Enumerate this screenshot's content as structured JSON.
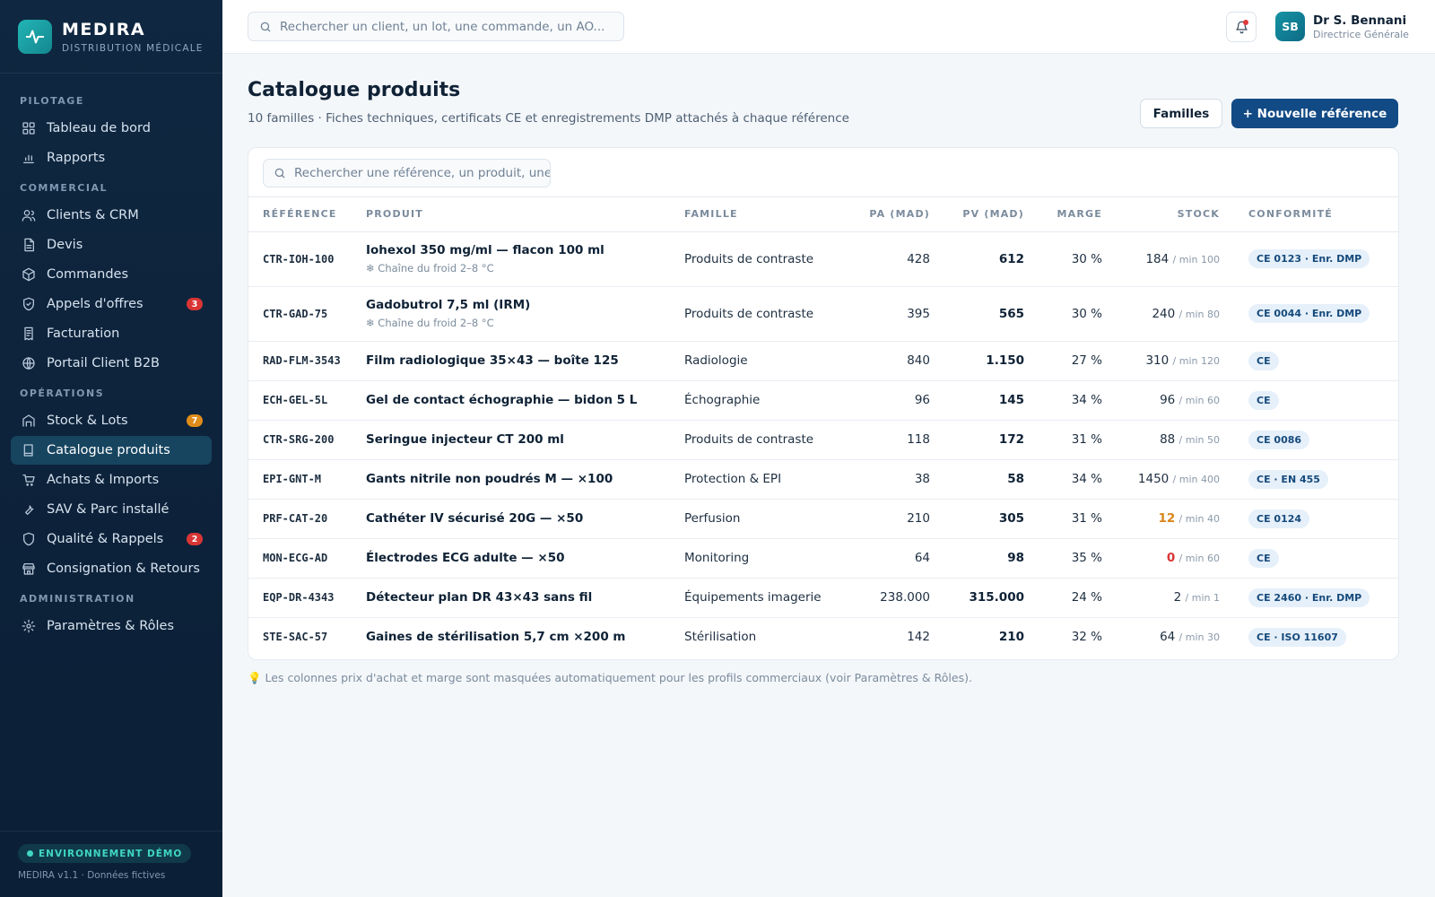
{
  "brand": {
    "name": "MEDIRA",
    "subtitle": "DISTRIBUTION MÉDICALE"
  },
  "sidebar": {
    "sections": [
      {
        "title": "PILOTAGE",
        "items": [
          {
            "label": "Tableau de bord",
            "icon": "dashboard-icon"
          },
          {
            "label": "Rapports",
            "icon": "bar-chart-icon"
          }
        ]
      },
      {
        "title": "COMMERCIAL",
        "items": [
          {
            "label": "Clients & CRM",
            "icon": "users-icon"
          },
          {
            "label": "Devis",
            "icon": "document-icon"
          },
          {
            "label": "Commandes",
            "icon": "box-icon"
          },
          {
            "label": "Appels d'offres",
            "icon": "shield-icon",
            "badge": "3",
            "badge_color": "#d93535"
          },
          {
            "label": "Facturation",
            "icon": "receipt-icon"
          },
          {
            "label": "Portail Client B2B",
            "icon": "globe-icon"
          }
        ]
      },
      {
        "title": "OPÉRATIONS",
        "items": [
          {
            "label": "Stock & Lots",
            "icon": "warehouse-icon",
            "badge": "7",
            "badge_color": "#e08c1a"
          },
          {
            "label": "Catalogue produits",
            "icon": "book-icon",
            "active": true
          },
          {
            "label": "Achats & Imports",
            "icon": "cart-icon"
          },
          {
            "label": "SAV & Parc installé",
            "icon": "wrench-icon"
          },
          {
            "label": "Qualité & Rappels",
            "icon": "shield-check-icon",
            "badge": "2",
            "badge_color": "#d93535"
          },
          {
            "label": "Consignation & Retours",
            "icon": "store-icon"
          }
        ]
      },
      {
        "title": "ADMINISTRATION",
        "items": [
          {
            "label": "Paramètres & Rôles",
            "icon": "gear-icon"
          }
        ]
      }
    ],
    "footer": {
      "env_label": "ENVIRONNEMENT DÉMO",
      "version": "MEDIRA v1.1 · Données fictives"
    }
  },
  "topbar": {
    "search_placeholder": "Rechercher un client, un lot, une commande, un AO...",
    "user": {
      "initials": "SB",
      "name": "Dr S. Bennani",
      "role": "Directrice Générale"
    }
  },
  "page": {
    "title": "Catalogue produits",
    "subtitle": "10 familles · Fiches techniques, certificats CE et enregistrements DMP attachés à chaque référence",
    "btn_families": "Familles",
    "btn_new": "+ Nouvelle référence",
    "table_search_placeholder": "Rechercher une référence, un produit, une famille",
    "footnote": "💡 Les colonnes prix d'achat et marge sont masquées automatiquement pour les profils commerciaux (voir Paramètres & Rôles)."
  },
  "table": {
    "columns": {
      "ref": "RÉFÉRENCE",
      "product": "PRODUIT",
      "family": "FAMILLE",
      "pa": "PA (MAD)",
      "pv": "PV (MAD)",
      "margin": "MARGE",
      "stock": "STOCK",
      "compliance": "CONFORMITÉ"
    },
    "rows": [
      {
        "ref": "CTR-IOH-100",
        "product": "Iohexol 350 mg/ml — flacon 100 ml",
        "note": "❄ Chaîne du froid 2–8 °C",
        "family": "Produits de contraste",
        "pa": "428",
        "pv": "612",
        "margin": "30 %",
        "stock": "184",
        "stock_min": "/ min 100",
        "stock_status": "ok",
        "compliance": "CE 0123 · Enr. DMP"
      },
      {
        "ref": "CTR-GAD-75",
        "product": "Gadobutrol 7,5 ml (IRM)",
        "note": "❄ Chaîne du froid 2–8 °C",
        "family": "Produits de contraste",
        "pa": "395",
        "pv": "565",
        "margin": "30 %",
        "stock": "240",
        "stock_min": "/ min 80",
        "stock_status": "ok",
        "compliance": "CE 0044 · Enr. DMP"
      },
      {
        "ref": "RAD-FLM-3543",
        "product": "Film radiologique 35×43 — boîte 125",
        "note": "",
        "family": "Radiologie",
        "pa": "840",
        "pv": "1.150",
        "margin": "27 %",
        "stock": "310",
        "stock_min": "/ min 120",
        "stock_status": "ok",
        "compliance": "CE"
      },
      {
        "ref": "ECH-GEL-5L",
        "product": "Gel de contact échographie — bidon 5 L",
        "note": "",
        "family": "Échographie",
        "pa": "96",
        "pv": "145",
        "margin": "34 %",
        "stock": "96",
        "stock_min": "/ min 60",
        "stock_status": "ok",
        "compliance": "CE"
      },
      {
        "ref": "CTR-SRG-200",
        "product": "Seringue injecteur CT 200 ml",
        "note": "",
        "family": "Produits de contraste",
        "pa": "118",
        "pv": "172",
        "margin": "31 %",
        "stock": "88",
        "stock_min": "/ min 50",
        "stock_status": "ok",
        "compliance": "CE 0086"
      },
      {
        "ref": "EPI-GNT-M",
        "product": "Gants nitrile non poudrés M — ×100",
        "note": "",
        "family": "Protection & EPI",
        "pa": "38",
        "pv": "58",
        "margin": "34 %",
        "stock": "1450",
        "stock_min": "/ min 400",
        "stock_status": "ok",
        "compliance": "CE · EN 455"
      },
      {
        "ref": "PRF-CAT-20",
        "product": "Cathéter IV sécurisé 20G — ×50",
        "note": "",
        "family": "Perfusion",
        "pa": "210",
        "pv": "305",
        "margin": "31 %",
        "stock": "12",
        "stock_min": "/ min 40",
        "stock_status": "warn",
        "compliance": "CE 0124"
      },
      {
        "ref": "MON-ECG-AD",
        "product": "Électrodes ECG adulte — ×50",
        "note": "",
        "family": "Monitoring",
        "pa": "64",
        "pv": "98",
        "margin": "35 %",
        "stock": "0",
        "stock_min": "/ min 60",
        "stock_status": "zero",
        "compliance": "CE"
      },
      {
        "ref": "EQP-DR-4343",
        "product": "Détecteur plan DR 43×43 sans fil",
        "note": "",
        "family": "Équipements imagerie",
        "pa": "238.000",
        "pv": "315.000",
        "margin": "24 %",
        "stock": "2",
        "stock_min": "/ min 1",
        "stock_status": "ok",
        "compliance": "CE 2460 · Enr. DMP"
      },
      {
        "ref": "STE-SAC-57",
        "product": "Gaines de stérilisation 5,7 cm ×200 m",
        "note": "",
        "family": "Stérilisation",
        "pa": "142",
        "pv": "210",
        "margin": "32 %",
        "stock": "64",
        "stock_min": "/ min 30",
        "stock_status": "ok",
        "compliance": "CE · ISO 11607"
      }
    ]
  }
}
